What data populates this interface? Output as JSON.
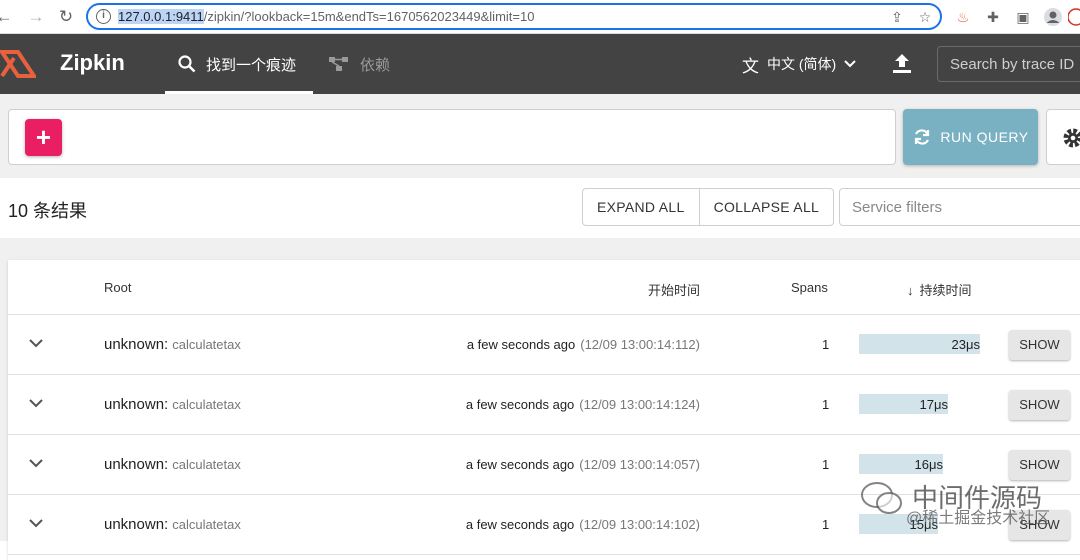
{
  "browser": {
    "url_host": "127.0.0.1:9411",
    "url_path": "/zipkin/?lookback=15m&endTs=1670562023449&limit=10"
  },
  "header": {
    "brand": "Zipkin",
    "tabs": [
      {
        "label": "找到一个痕迹",
        "icon": "search-icon"
      },
      {
        "label": "依赖",
        "icon": "dependency-graph-icon"
      }
    ],
    "language": "中文 (简体)",
    "trace_search_placeholder": "Search by trace ID"
  },
  "query": {
    "add_label": "+",
    "run_query_label": "RUN QUERY"
  },
  "results": {
    "count_label": "10 条结果",
    "expand_all_label": "EXPAND ALL",
    "collapse_all_label": "COLLAPSE ALL",
    "service_filter_placeholder": "Service filters"
  },
  "table": {
    "columns": {
      "root": "Root",
      "start_time": "开始时间",
      "spans": "Spans",
      "duration": "持续时间",
      "duration_sort_icon": "↓"
    },
    "rows": [
      {
        "service": "unknown:",
        "span_name": "calculatetax",
        "relative": "a few seconds ago",
        "absolute": "(12/09 13:00:14:112)",
        "spans": "1",
        "duration": "23μs",
        "duration_fraction": 1.0
      },
      {
        "service": "unknown:",
        "span_name": "calculatetax",
        "relative": "a few seconds ago",
        "absolute": "(12/09 13:00:14:124)",
        "spans": "1",
        "duration": "17μs",
        "duration_fraction": 0.739
      },
      {
        "service": "unknown:",
        "span_name": "calculatetax",
        "relative": "a few seconds ago",
        "absolute": "(12/09 13:00:14:057)",
        "spans": "1",
        "duration": "16μs",
        "duration_fraction": 0.696
      },
      {
        "service": "unknown:",
        "span_name": "calculatetax",
        "relative": "a few seconds ago",
        "absolute": "(12/09 13:00:14:102)",
        "spans": "1",
        "duration": "15μs",
        "duration_fraction": 0.652
      }
    ],
    "show_label": "SHOW"
  },
  "watermark": {
    "main": "中间件源码",
    "sub": "@稀土掘金技术社区"
  },
  "colors": {
    "appbar": "#434343",
    "accent_pink": "#e91e63",
    "run_query": "#7ab1c2",
    "duration_bar": "#d3e3ea"
  }
}
